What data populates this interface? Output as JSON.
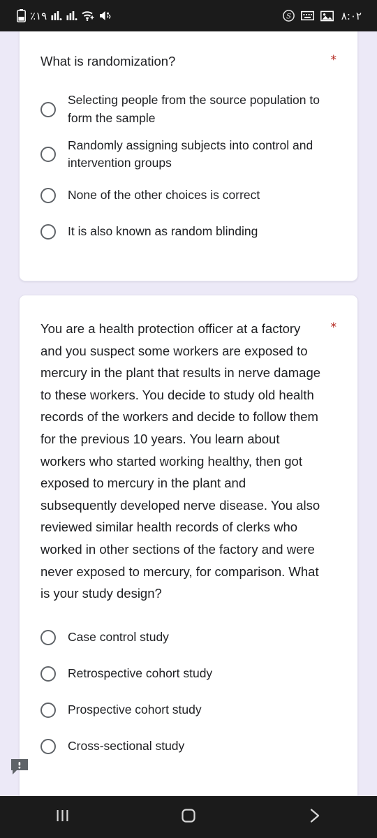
{
  "status_bar": {
    "battery_percent": "٪١٩",
    "clock": "٨:٠٢",
    "icons_left": [
      "battery-icon",
      "signal-bars-sim1-icon",
      "signal-bars-sim2-icon",
      "wifi-icon",
      "volume-mute-icon"
    ],
    "icons_right": [
      "s-circle-icon",
      "keyboard-icon",
      "screenshot-icon"
    ]
  },
  "questions": [
    {
      "id": "q1",
      "text": "What is randomization?",
      "required_marker": "*",
      "options": [
        "Selecting people from the source population to form the sample",
        "Randomly assigning subjects into control and intervention groups",
        "None of the other choices is correct",
        "It is also known as random blinding"
      ],
      "selected": null
    },
    {
      "id": "q2",
      "text": "You are a health protection officer at a factory and you suspect some workers are exposed to mercury in the plant that results in nerve damage to these workers. You decide to study old health records of the workers and decide to follow them for the previous 10 years. You learn about workers who started working healthy, then got exposed to mercury in the plant and subsequently developed nerve disease. You also reviewed similar health records of clerks who worked in other sections of the factory and were never exposed to mercury, for comparison. What is your study design?",
      "required_marker": "*",
      "options": [
        "Case control study",
        "Retrospective cohort study",
        "Prospective cohort study",
        "Cross-sectional study"
      ],
      "selected": null
    }
  ],
  "feedback_icon": "comment-alert-icon",
  "nav_bar": {
    "recents_label": "recents",
    "home_label": "home",
    "back_label": "back"
  },
  "colors": {
    "page_background": "#ece9f7",
    "card_background": "#ffffff",
    "text": "#202124",
    "required_asterisk": "#b3261e",
    "radio_border": "#5f6368",
    "system_bar": "#1b1b1b"
  }
}
